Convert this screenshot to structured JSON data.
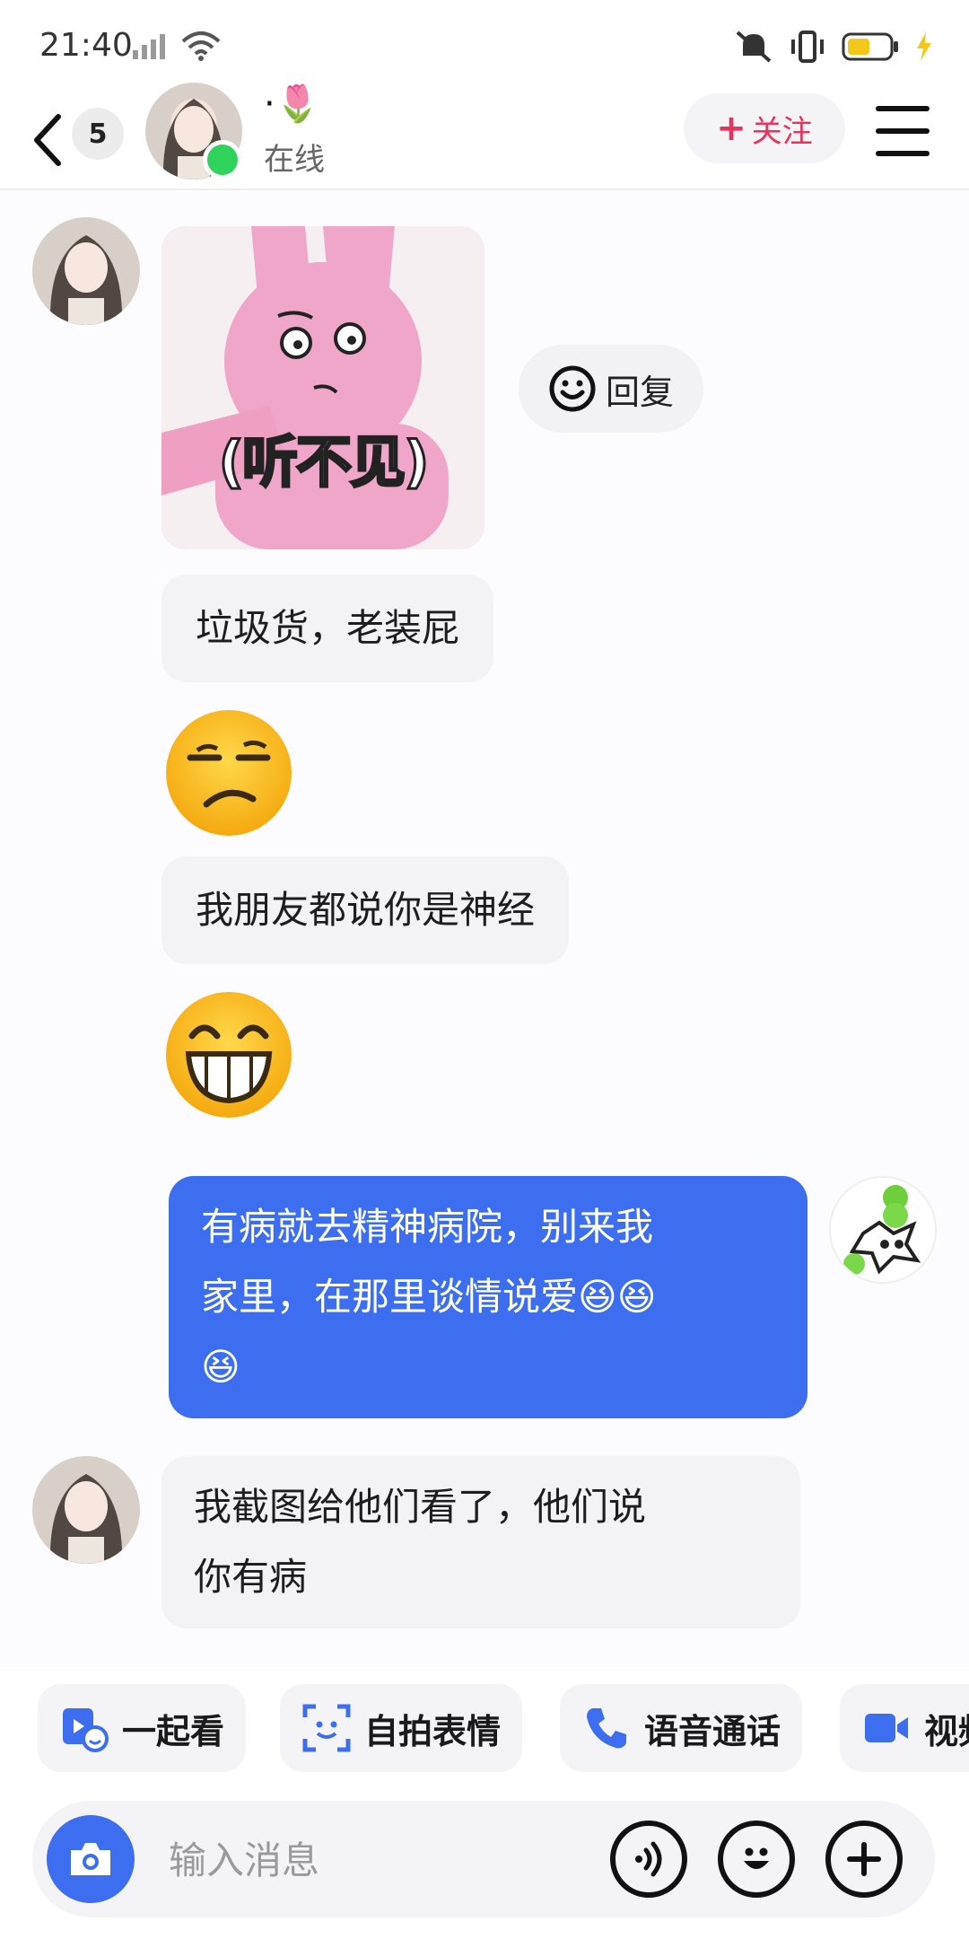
{
  "status_bar": {
    "time": "21:40"
  },
  "header": {
    "unread_count": "5",
    "contact_name": "·🌷",
    "contact_status": "在线",
    "follow_label": "关注",
    "follow_plus": "+"
  },
  "messages": [
    {
      "type": "sticker",
      "sender": "other",
      "text": "(听不见)"
    },
    {
      "type": "text",
      "sender": "other",
      "text": "垃圾货，老装屁"
    },
    {
      "type": "emoji",
      "sender": "other",
      "emoji": "smirk"
    },
    {
      "type": "text",
      "sender": "other",
      "text": "我朋友都说你是神经"
    },
    {
      "type": "emoji",
      "sender": "other",
      "emoji": "grin"
    },
    {
      "type": "text",
      "sender": "me",
      "lines": [
        "有病就去精神病院，别来我",
        "家里，在那里谈情说爱😆😆",
        "😆"
      ]
    },
    {
      "type": "text",
      "sender": "other",
      "lines": [
        "我截图给他们看了，他们说",
        "你有病"
      ]
    }
  ],
  "reply_button": {
    "label": "回复"
  },
  "quick_actions": [
    {
      "label": "一起看",
      "icon": "watch-together-icon"
    },
    {
      "label": "自拍表情",
      "icon": "selfie-sticker-icon"
    },
    {
      "label": "语音通话",
      "icon": "phone-icon"
    },
    {
      "label": "视频",
      "icon": "video-icon"
    }
  ],
  "input": {
    "placeholder": "输入消息"
  },
  "colors": {
    "accent": "#3d6ef0",
    "follow": "#e8335f",
    "online": "#2fd25a"
  }
}
